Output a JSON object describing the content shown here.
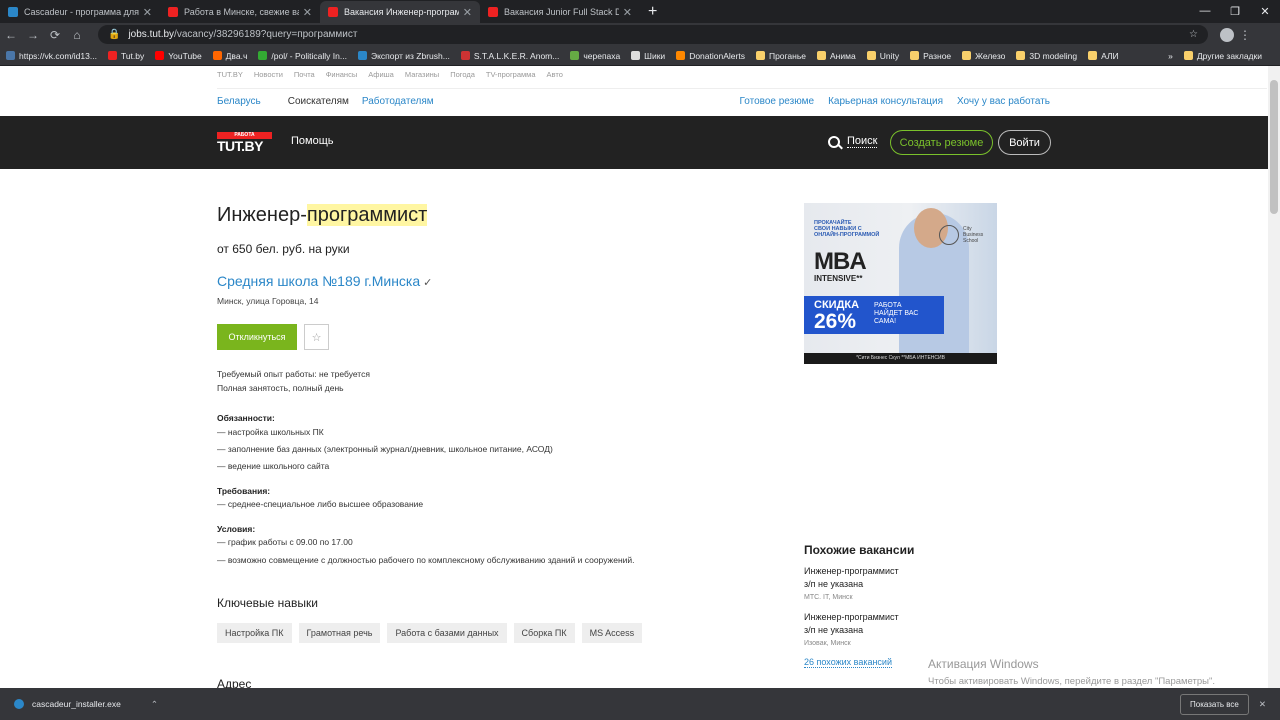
{
  "browser": {
    "tabs": [
      {
        "title": "Cascadeur - программа для phy",
        "color": "#2b87c8"
      },
      {
        "title": "Работа в Минске, свежие вакан",
        "color": "#e22"
      },
      {
        "title": "Вакансия Инженер-программист",
        "color": "#e22",
        "active": true
      },
      {
        "title": "Вакансия Junior Full Stack Devel",
        "color": "#e22"
      }
    ],
    "url_domain": "jobs.tut.by",
    "url_path": "/vacancy/38296189?query=программист",
    "bookmarks": [
      {
        "label": "https://vk.com/id13...",
        "color": "#4a76a8"
      },
      {
        "label": "Tut.by",
        "color": "#e22"
      },
      {
        "label": "YouTube",
        "color": "#f00"
      },
      {
        "label": "Два.ч",
        "color": "#f60"
      },
      {
        "label": "/pol/ - Politically In...",
        "color": "#3a3"
      },
      {
        "label": "Экспорт из Zbrush...",
        "color": "#2b87c8"
      },
      {
        "label": "S.T.A.L.K.E.R. Anom...",
        "color": "#c33"
      },
      {
        "label": "черепаха",
        "color": "#6a4"
      },
      {
        "label": "Шики",
        "color": "#ddd"
      },
      {
        "label": "DonationAlerts",
        "color": "#f80"
      },
      {
        "label": "Проганье",
        "folder": true
      },
      {
        "label": "Анима",
        "folder": true
      },
      {
        "label": "Unity",
        "folder": true
      },
      {
        "label": "Разное",
        "folder": true
      },
      {
        "label": "Железо",
        "folder": true
      },
      {
        "label": "3D modeling",
        "folder": true
      },
      {
        "label": "АЛИ",
        "folder": true
      }
    ],
    "other_bookmarks": "Другие закладки",
    "more": "»"
  },
  "site": {
    "topnav": [
      "TUT.BY",
      "Новости",
      "Почта",
      "Финансы",
      "Афиша",
      "Магазины",
      "Погода",
      "TV-программа",
      "Авто"
    ],
    "region": "Беларусь",
    "seekers": "Соискателям",
    "employers": "Работодателям",
    "right_links": [
      "Готовое резюме",
      "Карьерная консультация",
      "Хочу у вас работать"
    ],
    "logo_top": "РАБОТА",
    "logo_main": "TUT.BY",
    "help": "Помощь",
    "search": "Поиск",
    "create_cv": "Создать резюме",
    "login": "Войти"
  },
  "vacancy": {
    "title_a": "Инженер-",
    "title_b": "программист",
    "salary": "от 650 бел. руб. на руки",
    "company": "Средняя школа №189 г.Минска",
    "address": "Минск, улица Горовца, 14",
    "apply": "Откликнуться",
    "experience": "Требуемый опыт работы: не требуется",
    "employment": "Полная занятость, полный день",
    "duties_h": "Обязанности:",
    "duties": [
      "— настройка школьных ПК",
      "— заполнение баз данных (электронный журнал/дневник, школьное питание, АСОД)",
      "— ведение школьного сайта"
    ],
    "req_h": "Требования:",
    "req": [
      "— среднее-специальное либо высшее образование"
    ],
    "cond_h": "Условия:",
    "cond": [
      "— график работы с 09.00 по 17.00",
      "— возможно совмещение с должностью рабочего по комплексному обслуживанию зданий и сооружений."
    ],
    "skills_h": "Ключевые навыки",
    "skills": [
      "Настройка ПК",
      "Грамотная речь",
      "Работа с базами данных",
      "Сборка ПК",
      "MS Access"
    ],
    "address_h": "Адрес"
  },
  "ad": {
    "promo": [
      "ПРОКАЧАЙТЕ",
      "СВОИ НАВЫКИ С",
      "ОНЛАЙН-ПРОГРАММОЙ"
    ],
    "school": [
      "City",
      "Business",
      "School"
    ],
    "mba": "MBA",
    "intensive": "INTENSIVE**",
    "discount": "СКИДКА",
    "pct": "26%",
    "right": [
      "РАБОТА",
      "НАЙДЕТ ВАС",
      "САМА!"
    ],
    "footer": "*Сити Бизнес Скул **МБА ИНТЕНСИВ"
  },
  "similar": {
    "heading": "Похожие вакансии",
    "items": [
      {
        "title": "Инженер-программист",
        "salary": "з/п не указана",
        "meta": "МТС. IT, Минск"
      },
      {
        "title": "Инженер-программист",
        "salary": "з/п не указана",
        "meta": "Изовак, Минск"
      }
    ],
    "more": "26 похожих вакансий"
  },
  "watermark": {
    "a": "Активация Windows",
    "b": "Чтобы активировать Windows, перейдите в раздел \"Параметры\"."
  },
  "download": {
    "file": "cascadeur_installer.exe",
    "show_all": "Показать все"
  }
}
